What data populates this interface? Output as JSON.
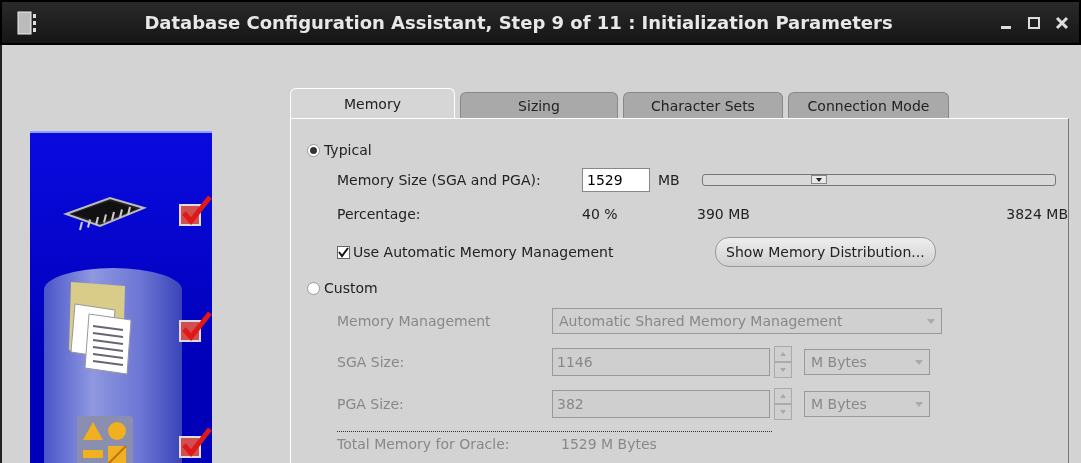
{
  "window": {
    "title": "Database Configuration Assistant, Step 9 of 11 : Initialization Parameters"
  },
  "steps": [
    {
      "kind": "chip",
      "checked": true
    },
    {
      "kind": "documents",
      "checked": true
    },
    {
      "kind": "shapes",
      "checked": true
    }
  ],
  "tabs": [
    {
      "label": "Memory",
      "selected": true
    },
    {
      "label": "Sizing",
      "selected": false
    },
    {
      "label": "Character Sets",
      "selected": false
    },
    {
      "label": "Connection Mode",
      "selected": false
    }
  ],
  "typical": {
    "label": "Typical",
    "selected": true,
    "memory_size_label": "Memory Size (SGA and PGA):",
    "memory_size_value": "1529",
    "memory_size_unit": "MB",
    "slider": {
      "level": 0.33,
      "min_label": "390 MB",
      "max_label": "3824 MB"
    },
    "percentage_label": "Percentage:",
    "percentage_value": "40 %",
    "amm": {
      "label": "Use Automatic Memory Management",
      "checked": true
    },
    "show_button": "Show Memory Distribution..."
  },
  "custom": {
    "label": "Custom",
    "selected": false,
    "disabled": true,
    "memory_management": {
      "label": "Memory Management",
      "value": "Automatic Shared Memory Management"
    },
    "sga": {
      "label": "SGA Size:",
      "value": "1146",
      "unit": "M Bytes"
    },
    "pga": {
      "label": "PGA Size:",
      "value": "382",
      "unit": "M Bytes"
    },
    "total": {
      "label": "Total Memory for Oracle:",
      "value": "1529 M Bytes"
    }
  }
}
